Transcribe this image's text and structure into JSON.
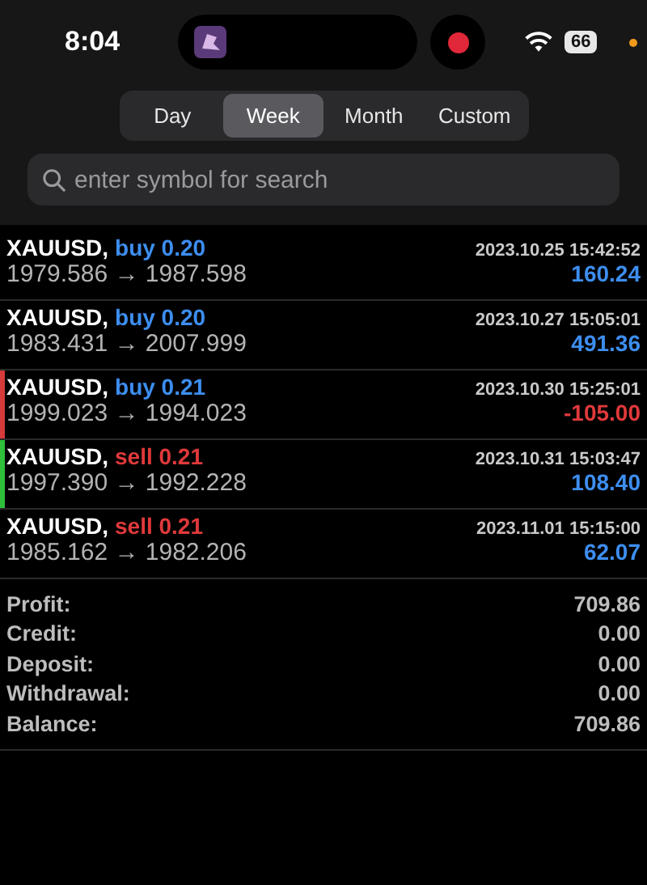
{
  "status_bar": {
    "time": "8:04",
    "recording": true,
    "battery": "66",
    "privacy_dot": true
  },
  "tabs": [
    {
      "label": "Day",
      "selected": false
    },
    {
      "label": "Week",
      "selected": true
    },
    {
      "label": "Month",
      "selected": false
    },
    {
      "label": "Custom",
      "selected": false
    }
  ],
  "search": {
    "placeholder": "enter symbol for search"
  },
  "trades": [
    {
      "symbol": "XAUUSD,",
      "side": "buy",
      "volume": "0.20",
      "prices": "1979.586 → 1987.598",
      "time": "2023.10.25 15:42:52",
      "profit": "160.24",
      "loss": false
    },
    {
      "symbol": "XAUUSD,",
      "side": "buy",
      "volume": "0.20",
      "prices": "1983.431 → 2007.999",
      "time": "2023.10.27 15:05:01",
      "profit": "491.36",
      "loss": false
    },
    {
      "symbol": "XAUUSD,",
      "side": "buy",
      "volume": "0.21",
      "prices": "1999.023 → 1994.023",
      "time": "2023.10.30 15:25:01",
      "profit": "-105.00",
      "loss": true,
      "color": "#d63a3a"
    },
    {
      "symbol": "XAUUSD,",
      "side": "sell",
      "volume": "0.21",
      "prices": "1997.390 → 1992.228",
      "time": "2023.10.31 15:03:47",
      "profit": "108.40",
      "loss": false,
      "color": "#2fbf3a"
    },
    {
      "symbol": "XAUUSD,",
      "side": "sell",
      "volume": "0.21",
      "prices": "1985.162 → 1982.206",
      "time": "2023.11.01 15:15:00",
      "profit": "62.07",
      "loss": false
    }
  ],
  "summary": [
    {
      "label": "Profit:",
      "value": "709.86"
    },
    {
      "label": "Credit:",
      "value": "0.00"
    },
    {
      "label": "Deposit:",
      "value": "0.00"
    },
    {
      "label": "Withdrawal:",
      "value": "0.00"
    },
    {
      "label": "Balance:",
      "value": "709.86"
    }
  ]
}
